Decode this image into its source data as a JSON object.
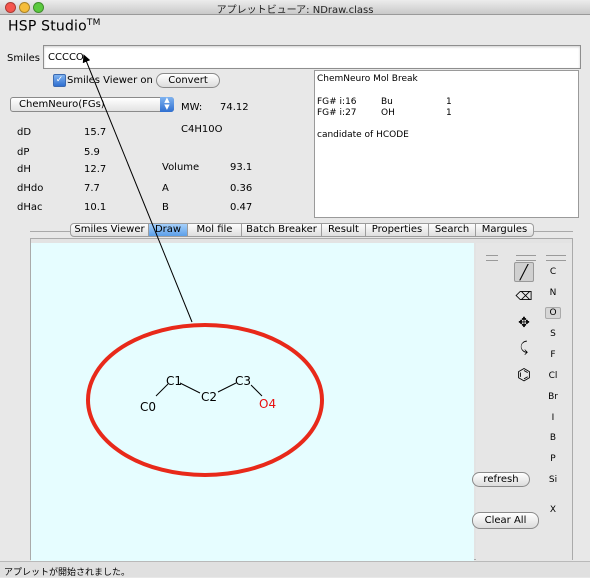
{
  "window": {
    "title": "アプレットビューア: NDraw.class"
  },
  "app": {
    "name": "HSP Studio",
    "trademark": "TM"
  },
  "smiles": {
    "label": "Smiles",
    "value": "CCCCO"
  },
  "viewer": {
    "checkbox_label": "Smiles Viewer on",
    "checked": true,
    "convert_label": "Convert"
  },
  "source_select": {
    "value": "ChemNeuro(FGs)"
  },
  "molecule": {
    "mw_label": "MW:",
    "mw_value": "74.12",
    "formula": "C4H10O"
  },
  "properties": {
    "dD": {
      "label": "dD",
      "value": "15.7"
    },
    "dP": {
      "label": "dP",
      "value": "5.9"
    },
    "dH": {
      "label": "dH",
      "value": "12.7"
    },
    "dHdo": {
      "label": "dHdo",
      "value": "7.7"
    },
    "dHac": {
      "label": "dHac",
      "value": "10.1"
    },
    "volume": {
      "label": "Volume",
      "value": "93.1"
    },
    "A": {
      "label": "A",
      "value": "0.36"
    },
    "B": {
      "label": "B",
      "value": "0.47"
    }
  },
  "break_box": {
    "title": "ChemNeuro Mol Break",
    "rows": [
      {
        "id": "FG# i:16",
        "group": "Bu",
        "count": "1"
      },
      {
        "id": "FG# i:27",
        "group": "OH",
        "count": "1"
      }
    ],
    "note": "candidate of HCODE"
  },
  "tabs": [
    "Smiles Viewer",
    "Draw",
    "Mol file",
    "Batch Breaker",
    "Result",
    "Properties",
    "Search",
    "Margules"
  ],
  "active_tab": "Draw",
  "atoms": [
    {
      "label": "C0",
      "color": "#000000"
    },
    {
      "label": "C1",
      "color": "#000000"
    },
    {
      "label": "C2",
      "color": "#000000"
    },
    {
      "label": "C3",
      "color": "#000000"
    },
    {
      "label": "O4",
      "color": "#e81010"
    }
  ],
  "elements": [
    "C",
    "N",
    "O",
    "S",
    "F",
    "Cl",
    "Br",
    "I",
    "B",
    "P",
    "Si",
    "X"
  ],
  "selected_element": "O",
  "tools": [
    "line-tool-icon",
    "eraser-icon",
    "move-icon",
    "rotate-icon",
    "benzene-ring-icon"
  ],
  "buttons": {
    "refresh": "refresh",
    "clear_all": "Clear All"
  },
  "status": {
    "text": "アプレットが開始されました。"
  },
  "colors": {
    "canvas_bg": "#e6fdff",
    "highlight_ellipse": "#e8291a",
    "oxygen": "#e81010",
    "tab_active": "#5c9fe8"
  }
}
